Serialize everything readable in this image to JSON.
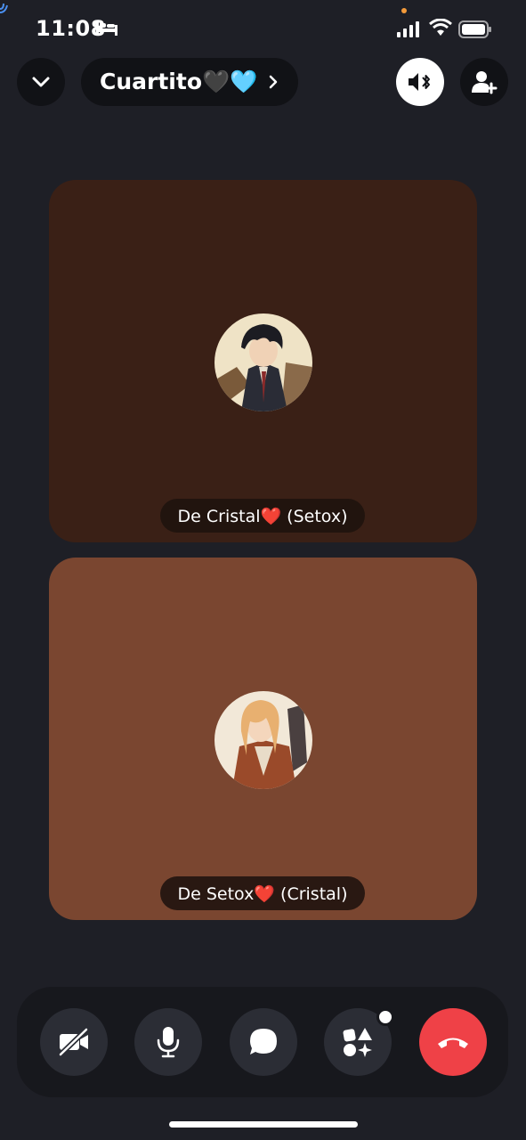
{
  "status_bar": {
    "time": "11:08"
  },
  "header": {
    "channel_name": "Cuartito🖤🩵"
  },
  "participants": [
    {
      "label": "De Cristal❤️ (Setox)",
      "tile_color": "#3a2016"
    },
    {
      "label": "De Setox❤️ (Cristal)",
      "tile_color": "#7a4630"
    }
  ],
  "controls": {
    "leave_color": "#ef4147",
    "icons": [
      "camera-off-icon",
      "microphone-icon",
      "chat-icon",
      "activities-icon",
      "hang-up-icon"
    ]
  },
  "colors": {
    "background": "#1e1f26",
    "button_dark": "#111216",
    "control_bg": "#2b2d35"
  }
}
